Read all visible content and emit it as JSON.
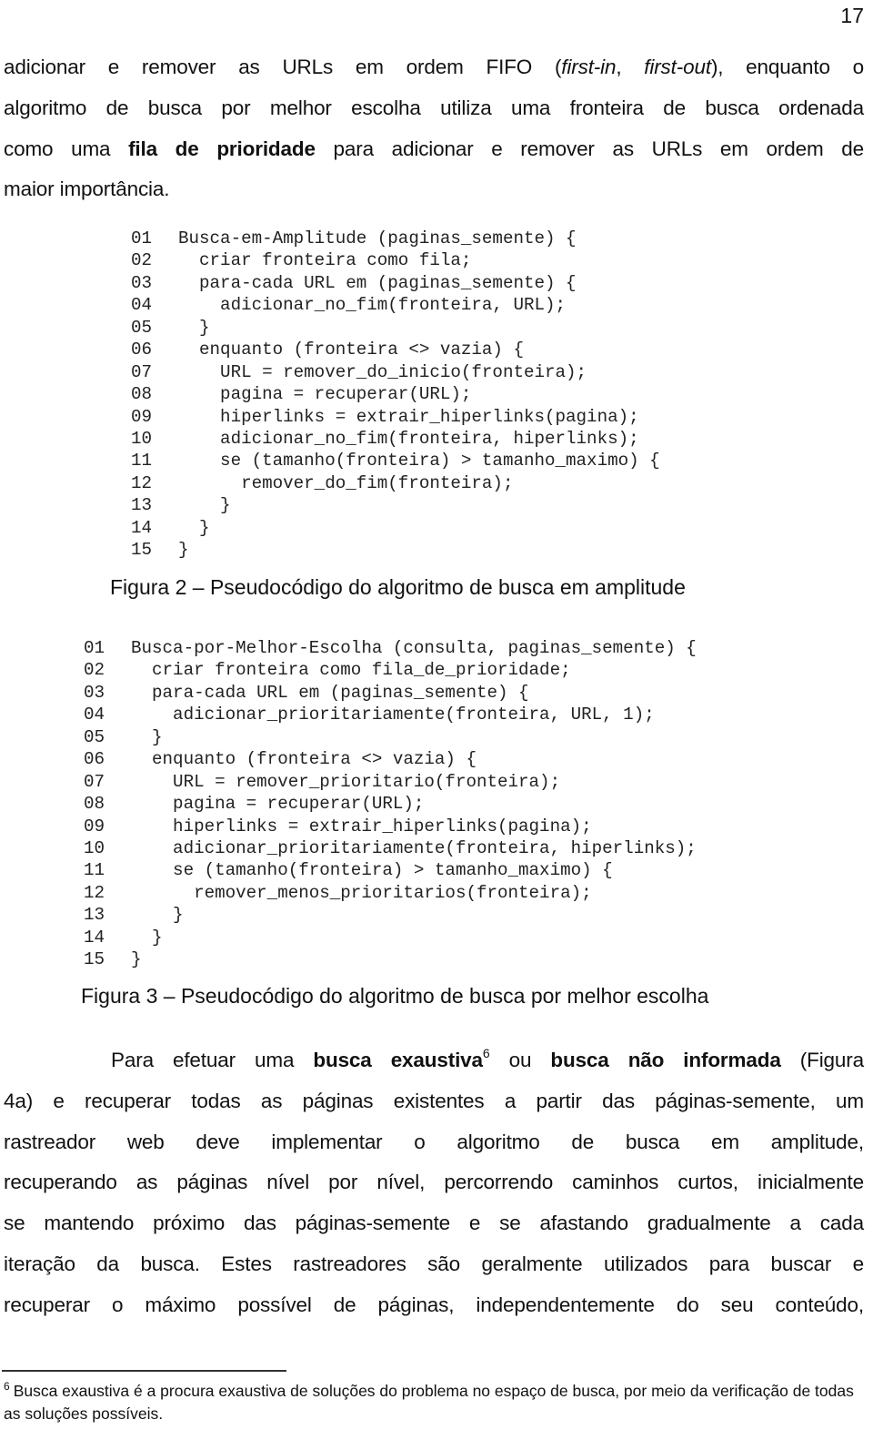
{
  "page_number": "17",
  "paragraph_1": {
    "lines": [
      [
        {
          "t": "adicionar e remover as URLs em ordem FIFO ("
        },
        {
          "t": "first-in",
          "i": true
        },
        {
          "t": ", "
        },
        {
          "t": "first-out",
          "i": true
        },
        {
          "t": "), enquanto o"
        }
      ],
      [
        {
          "t": "algoritmo de busca por melhor escolha utiliza uma fronteira de busca ordenada"
        }
      ],
      [
        {
          "t": "como uma "
        },
        {
          "t": "fila de prioridade",
          "b": true
        },
        {
          "t": " para adicionar e remover as URLs em ordem de"
        }
      ],
      [
        {
          "t": "maior importância."
        }
      ]
    ]
  },
  "figure_2": {
    "code": [
      {
        "n": "01",
        "text": "Busca-em-Amplitude (paginas_semente) {"
      },
      {
        "n": "02",
        "text": "  criar fronteira como fila;"
      },
      {
        "n": "03",
        "text": "  para-cada URL em (paginas_semente) {"
      },
      {
        "n": "04",
        "text": "    adicionar_no_fim(fronteira, URL);"
      },
      {
        "n": "05",
        "text": "  }"
      },
      {
        "n": "06",
        "text": "  enquanto (fronteira <> vazia) {"
      },
      {
        "n": "07",
        "text": "    URL = remover_do_inicio(fronteira);"
      },
      {
        "n": "08",
        "text": "    pagina = recuperar(URL);"
      },
      {
        "n": "09",
        "text": "    hiperlinks = extrair_hiperlinks(pagina);"
      },
      {
        "n": "10",
        "text": "    adicionar_no_fim(fronteira, hiperlinks);"
      },
      {
        "n": "11",
        "text": "    se (tamanho(fronteira) > tamanho_maximo) {"
      },
      {
        "n": "12",
        "text": "      remover_do_fim(fronteira);"
      },
      {
        "n": "13",
        "text": "    }"
      },
      {
        "n": "14",
        "text": "  }"
      },
      {
        "n": "15",
        "text": "}"
      }
    ],
    "caption": "Figura 2 – Pseudocódigo do algoritmo de busca em amplitude"
  },
  "figure_3": {
    "code": [
      {
        "n": "01",
        "text": "Busca-por-Melhor-Escolha (consulta, paginas_semente) {"
      },
      {
        "n": "02",
        "text": "  criar fronteira como fila_de_prioridade;"
      },
      {
        "n": "03",
        "text": "  para-cada URL em (paginas_semente) {"
      },
      {
        "n": "04",
        "text": "    adicionar_prioritariamente(fronteira, URL, 1);"
      },
      {
        "n": "05",
        "text": "  }"
      },
      {
        "n": "06",
        "text": "  enquanto (fronteira <> vazia) {"
      },
      {
        "n": "07",
        "text": "    URL = remover_prioritario(fronteira);"
      },
      {
        "n": "08",
        "text": "    pagina = recuperar(URL);"
      },
      {
        "n": "09",
        "text": "    hiperlinks = extrair_hiperlinks(pagina);"
      },
      {
        "n": "10",
        "text": "    adicionar_prioritariamente(fronteira, hiperlinks);"
      },
      {
        "n": "11",
        "text": "    se (tamanho(fronteira) > tamanho_maximo) {"
      },
      {
        "n": "12",
        "text": "      remover_menos_prioritarios(fronteira);"
      },
      {
        "n": "13",
        "text": "    }"
      },
      {
        "n": "14",
        "text": "  }"
      },
      {
        "n": "15",
        "text": "}"
      }
    ],
    "caption": "Figura 3 – Pseudocódigo do algoritmo de busca por melhor escolha"
  },
  "paragraph_2": {
    "lines": [
      [
        {
          "t": "Para efetuar uma "
        },
        {
          "t": "busca exaustiva",
          "b": true
        },
        {
          "t": "6",
          "sup": true
        },
        {
          "t": " ou "
        },
        {
          "t": "busca não informada",
          "b": true
        },
        {
          "t": " (Figura"
        }
      ],
      [
        {
          "t": "4a) e recuperar todas as páginas existentes a partir das páginas-semente, um"
        }
      ],
      [
        {
          "t": "rastreador web deve implementar o algoritmo de busca em amplitude,"
        }
      ],
      [
        {
          "t": "recuperando as páginas nível por nível, percorrendo caminhos curtos, inicialmente"
        }
      ],
      [
        {
          "t": "se mantendo próximo das páginas-semente e se afastando gradualmente a cada"
        }
      ],
      [
        {
          "t": "iteração da busca. Estes rastreadores são geralmente utilizados para buscar e"
        }
      ],
      [
        {
          "t": "recuperar o máximo possível de páginas, independentemente do seu conteúdo,"
        }
      ]
    ]
  },
  "footnote": {
    "mark": "6",
    "text": "Busca exaustiva é a procura exaustiva de soluções do problema no espaço de busca, por meio da verificação de todas as soluções possíveis."
  }
}
